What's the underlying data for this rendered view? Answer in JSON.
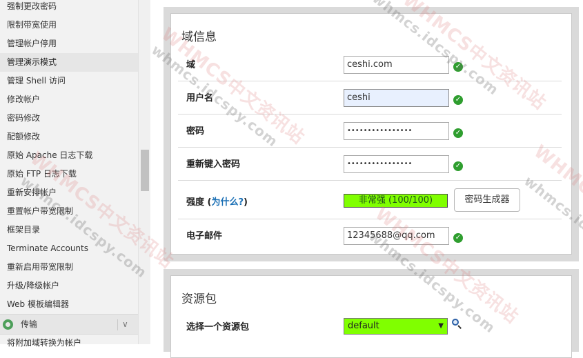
{
  "sidebar": {
    "items": [
      {
        "label": "强制更改密码"
      },
      {
        "label": "限制带宽使用"
      },
      {
        "label": "管理帐户停用"
      },
      {
        "label": "管理演示模式"
      },
      {
        "label": "管理 Shell 访问"
      },
      {
        "label": "修改帐户"
      },
      {
        "label": "密码修改"
      },
      {
        "label": "配额修改"
      },
      {
        "label": "原始 Apache 日志下载"
      },
      {
        "label": "原始 FTP 日志下载"
      },
      {
        "label": "重新安排帐户"
      },
      {
        "label": "重置帐户带宽限制"
      },
      {
        "label": "框架目录"
      },
      {
        "label": "Terminate Accounts"
      },
      {
        "label": "重新启用带宽限制"
      },
      {
        "label": "升级/降级帐户"
      },
      {
        "label": "Web 模板编辑器"
      }
    ],
    "group": {
      "label": "传输",
      "chevron": "∨",
      "icon": "transfer-icon"
    },
    "tail_item": "将附加域转换为帐户"
  },
  "domain_info": {
    "title": "域信息",
    "domain": {
      "label": "域",
      "value": "ceshi.com"
    },
    "username": {
      "label": "用户名",
      "value": "ceshi"
    },
    "password": {
      "label": "密码",
      "value": "••••••••••••••••"
    },
    "password_confirm": {
      "label": "重新键入密码",
      "value": "••••••••••••••••"
    },
    "strength": {
      "label": "强度",
      "what_link": "为什么?",
      "meter_text": "非常强 (100/100)",
      "meter_value": 100,
      "meter_color": "#80ff00"
    },
    "generator_button": "密码生成器",
    "email": {
      "label": "电子邮件",
      "value": "12345688@qq.com"
    },
    "valid_mark": "✓"
  },
  "package": {
    "title": "资源包",
    "select_label": "选择一个资源包",
    "selected": "default",
    "arrow": "▼"
  },
  "watermark": {
    "text_cn": "WHMCS中文资讯站",
    "text_url": "whmcs.idcspy.com"
  }
}
